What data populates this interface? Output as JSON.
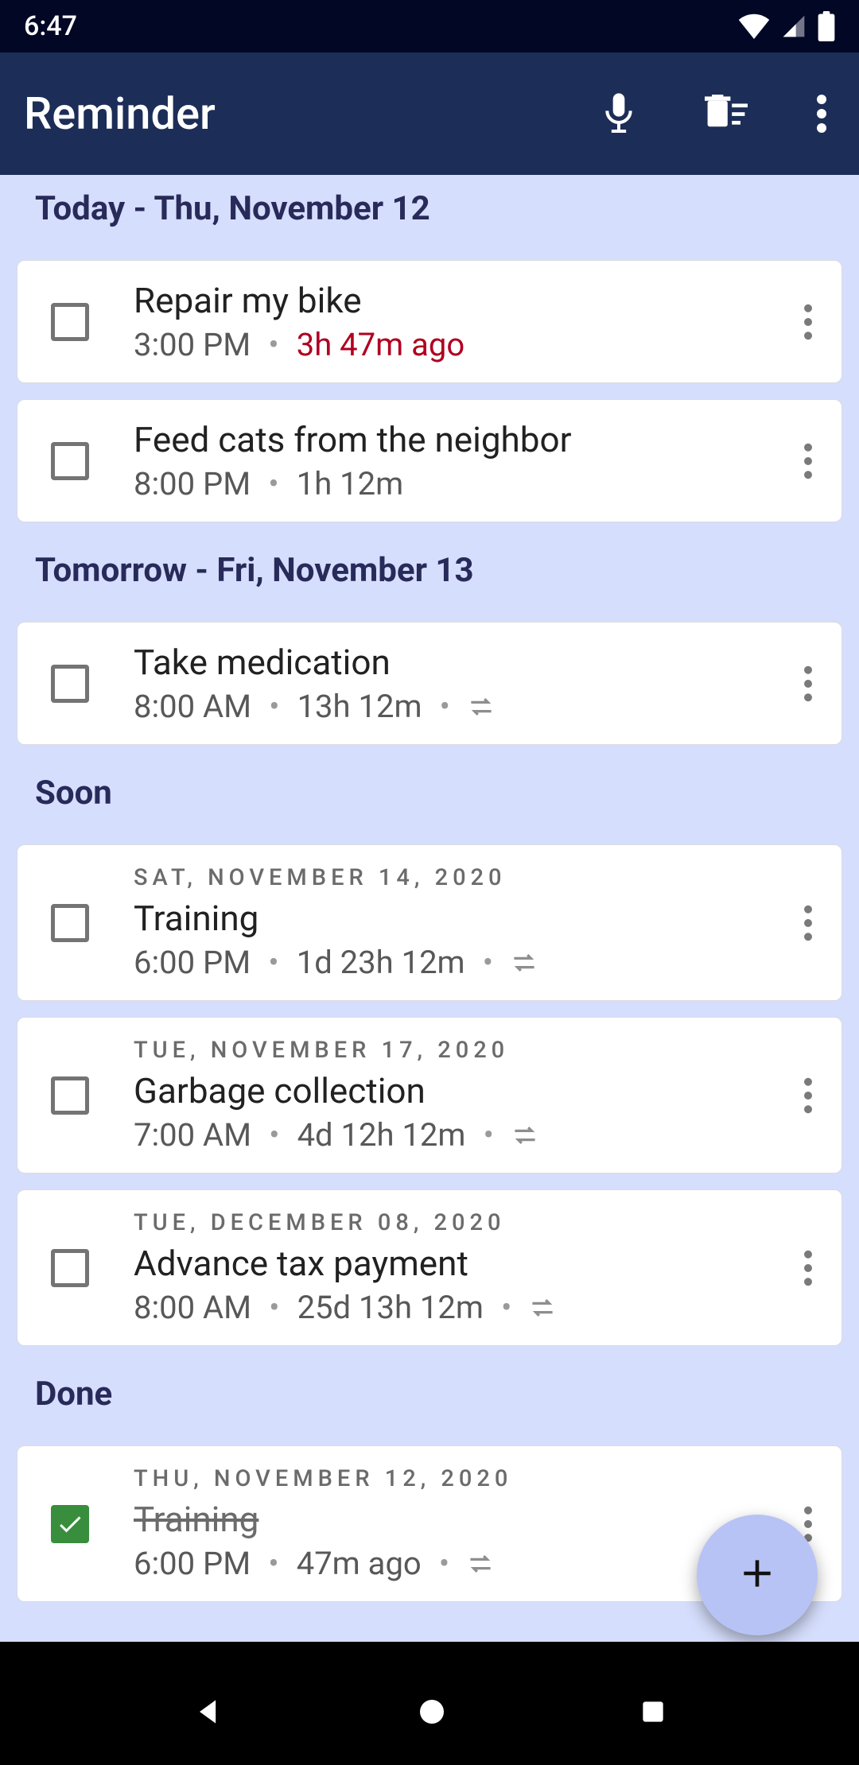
{
  "status_bar": {
    "time": "6:47"
  },
  "app_bar": {
    "title": "Reminder"
  },
  "sections": {
    "today": {
      "header": "Today - Thu, November 12",
      "items": [
        {
          "title": "Repair my bike",
          "time": "3:00 PM",
          "rel": "3h 47m ago",
          "overdue": true,
          "repeat": false
        },
        {
          "title": "Feed cats from the neighbor",
          "time": "8:00 PM",
          "rel": "1h 12m",
          "overdue": false,
          "repeat": false
        }
      ]
    },
    "tomorrow": {
      "header": "Tomorrow - Fri, November 13",
      "items": [
        {
          "title": "Take medication",
          "time": "8:00 AM",
          "rel": "13h 12m",
          "repeat": true
        }
      ]
    },
    "soon": {
      "header": "Soon",
      "items": [
        {
          "date": "SAT, NOVEMBER 14, 2020",
          "title": "Training",
          "time": "6:00 PM",
          "rel": "1d 23h 12m",
          "repeat": true
        },
        {
          "date": "TUE, NOVEMBER 17, 2020",
          "title": "Garbage collection",
          "time": "7:00 AM",
          "rel": "4d 12h 12m",
          "repeat": true
        },
        {
          "date": "TUE, DECEMBER 08, 2020",
          "title": "Advance tax payment",
          "time": "8:00 AM",
          "rel": "25d 13h 12m",
          "repeat": true
        }
      ]
    },
    "done": {
      "header": "Done",
      "items": [
        {
          "date": "THU, NOVEMBER 12, 2020",
          "title": "Training",
          "time": "6:00 PM",
          "rel": "47m ago",
          "repeat": true,
          "done": true
        }
      ]
    }
  }
}
